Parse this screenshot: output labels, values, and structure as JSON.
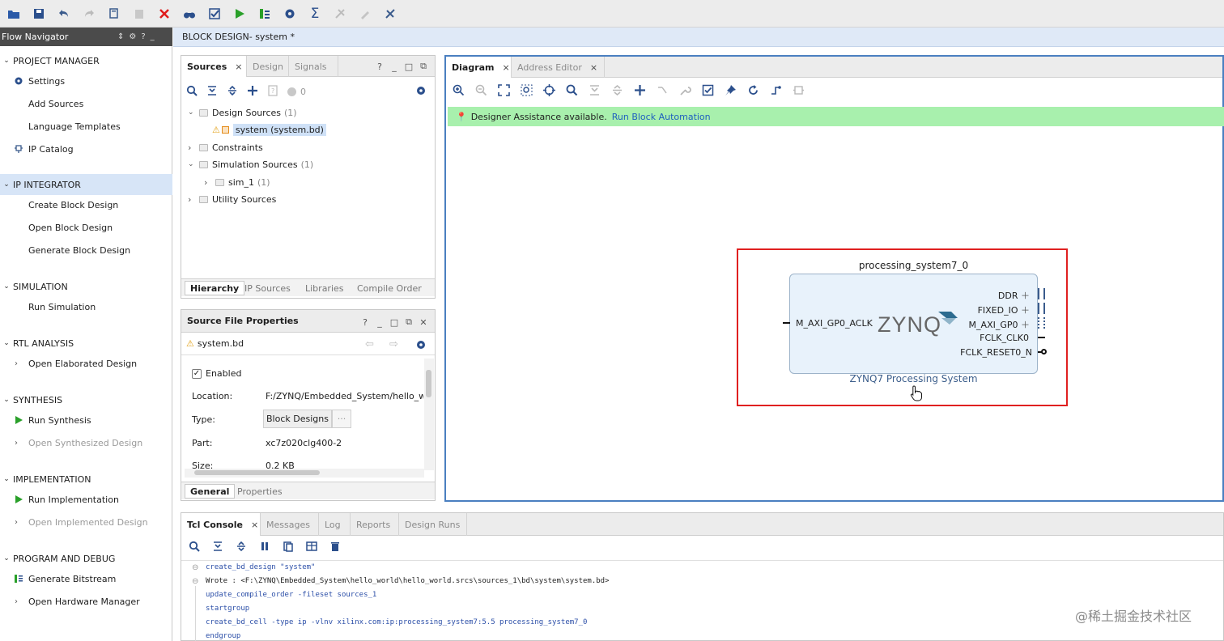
{
  "toolbar": {
    "icons": [
      "open-project-icon",
      "save-icon",
      "undo-icon",
      "redo-icon",
      "copy-icon",
      "paste-icon",
      "delete-icon",
      "binoculars-icon",
      "checkmark-icon",
      "run-icon",
      "program-icon",
      "settings-icon",
      "sigma-icon",
      "compile-icon",
      "edit-icon",
      "tools-icon"
    ]
  },
  "flow_navigator": {
    "title": "Flow Navigator",
    "header_controls": [
      "⇕",
      "⚙",
      "?",
      "_"
    ],
    "sections": [
      {
        "label": "PROJECT MANAGER"
      },
      {
        "label": "IP INTEGRATOR"
      },
      {
        "label": "SIMULATION"
      },
      {
        "label": "RTL ANALYSIS"
      },
      {
        "label": "SYNTHESIS"
      },
      {
        "label": "IMPLEMENTATION"
      },
      {
        "label": "PROGRAM AND DEBUG"
      }
    ],
    "items": {
      "settings": "Settings",
      "add_sources": "Add Sources",
      "language_templates": "Language Templates",
      "ip_catalog": "IP Catalog",
      "create_block_design": "Create Block Design",
      "open_block_design": "Open Block Design",
      "generate_block_design": "Generate Block Design",
      "run_simulation": "Run Simulation",
      "open_elaborated_design": "Open Elaborated Design",
      "run_synthesis": "Run Synthesis",
      "open_synthesized_design": "Open Synthesized Design",
      "run_implementation": "Run Implementation",
      "open_implemented_design": "Open Implemented Design",
      "generate_bitstream": "Generate Bitstream",
      "open_hardware_manager": "Open Hardware Manager"
    }
  },
  "block_design_bar": {
    "prefix": "BLOCK DESIGN",
    "name": " - system *"
  },
  "sources": {
    "tabs": [
      "Sources",
      "Design",
      "Signals"
    ],
    "close": "×",
    "counter": "0",
    "tree": {
      "design_sources": "Design Sources",
      "design_sources_count": "(1)",
      "system_file": "system (system.bd)",
      "constraints": "Constraints",
      "simulation_sources": "Simulation Sources",
      "simulation_sources_count": "(1)",
      "sim_1": "sim_1",
      "sim_1_count": "(1)",
      "utility_sources": "Utility Sources"
    },
    "bottom_tabs": [
      "Hierarchy",
      "IP Sources",
      "Libraries",
      "Compile Order"
    ]
  },
  "source_props": {
    "title": "Source File Properties",
    "file": "system.bd",
    "enabled_label": "Enabled",
    "location_label": "Location:",
    "location_value": "F:/ZYNQ/Embedded_System/hello_worl",
    "type_label": "Type:",
    "type_value": "Block Designs",
    "type_more": "···",
    "part_label": "Part:",
    "part_value": "xc7z020clg400-2",
    "size_label": "Size:",
    "size_value": "0.2 KB",
    "bottom_tabs": [
      "General",
      "Properties"
    ]
  },
  "diagram": {
    "tabs": [
      "Diagram",
      "Address Editor"
    ],
    "close": "×",
    "assist_text": "Designer Assistance available.",
    "assist_link": "Run Block Automation",
    "block": {
      "instance_name": "processing_system7_0",
      "logo": "ZYNQ",
      "caption": "ZYNQ7 Processing System",
      "left_port": "M_AXI_GP0_ACLK",
      "right_ports": [
        "DDR",
        "FIXED_IO",
        "M_AXI_GP0",
        "FCLK_CLK0",
        "FCLK_RESET0_N"
      ]
    },
    "colors": {
      "highlight": "#e02020",
      "assist_bg": "#a8f0ad",
      "link": "#1f5fbf"
    }
  },
  "tcl": {
    "tabs": [
      "Tcl Console",
      "Messages",
      "Log",
      "Reports",
      "Design Runs"
    ],
    "close": "×",
    "lines": [
      {
        "text": "create_bd_design \"system\"",
        "kind": "cmd"
      },
      {
        "text": "Wrote  : <F:\\ZYNQ\\Embedded_System\\hello_world\\hello_world.srcs\\sources_1\\bd\\system\\system.bd>",
        "kind": "out"
      },
      {
        "text": "update_compile_order -fileset sources_1",
        "kind": "cmd"
      },
      {
        "text": "startgroup",
        "kind": "cmd"
      },
      {
        "text": "create_bd_cell -type ip -vlnv xilinx.com:ip:processing_system7:5.5 processing_system7_0",
        "kind": "cmd"
      },
      {
        "text": "endgroup",
        "kind": "cmd"
      }
    ]
  },
  "watermark": "@稀土掘金技术社区"
}
